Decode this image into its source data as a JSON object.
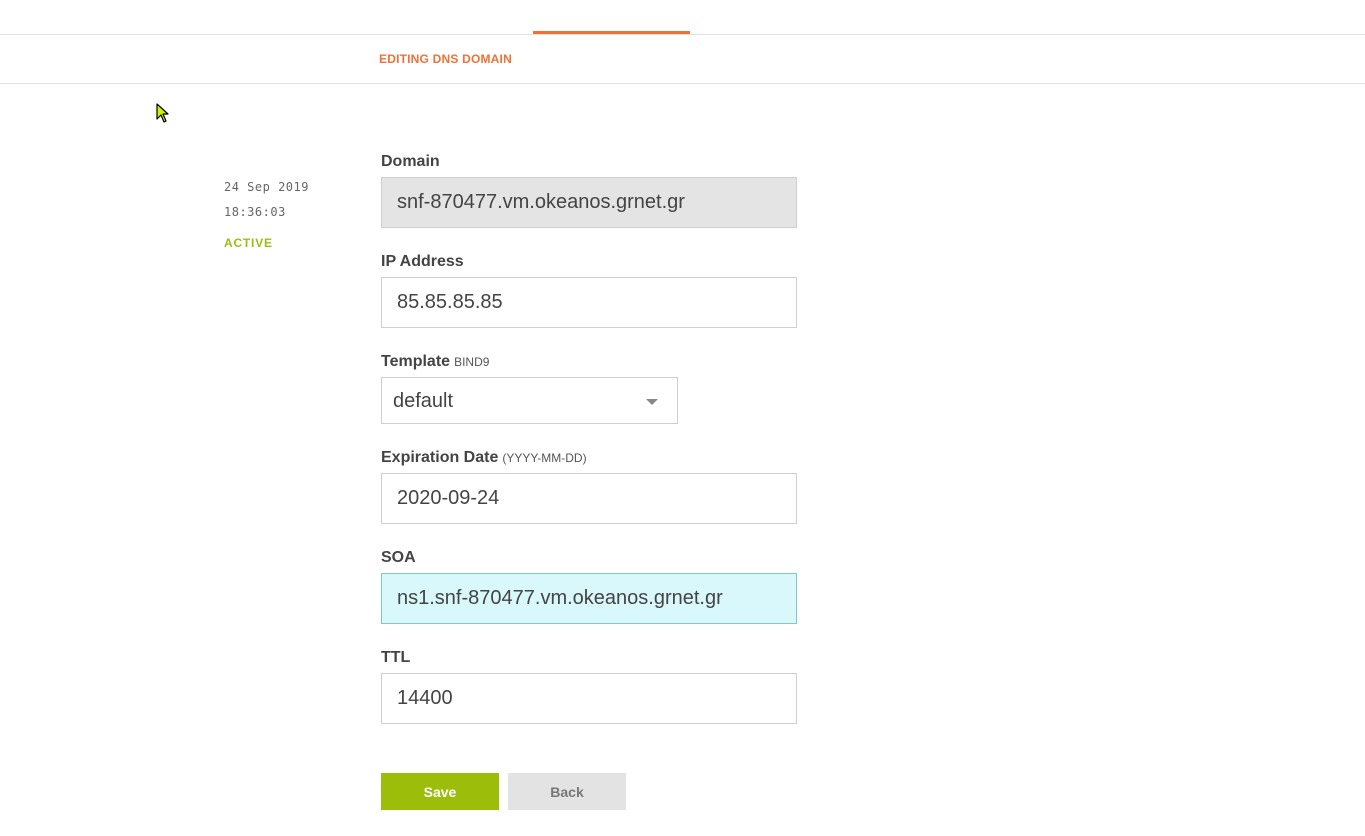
{
  "header": {
    "tab_title": "EDITING DNS DOMAIN"
  },
  "meta": {
    "date": "24 Sep 2019 18:36:03",
    "status": "ACTIVE"
  },
  "form": {
    "domain": {
      "label": "Domain",
      "value": "snf-870477.vm.okeanos.grnet.gr"
    },
    "ip_address": {
      "label": "IP Address",
      "value": "85.85.85.85"
    },
    "template": {
      "label": "Template",
      "hint": "BIND9",
      "selected": "default"
    },
    "expiration_date": {
      "label": "Expiration Date",
      "hint": "(YYYY-MM-DD)",
      "value": "2020-09-24"
    },
    "soa": {
      "label": "SOA",
      "value": "ns1.snf-870477.vm.okeanos.grnet.gr"
    },
    "ttl": {
      "label": "TTL",
      "value": "14400"
    }
  },
  "buttons": {
    "save": "Save",
    "back": "Back"
  },
  "colors": {
    "accent": "#f07137",
    "status_active": "#9cbd14",
    "save_button": "#9cbd0a",
    "focused_input": "#d8f8fc"
  },
  "icons": {
    "cursor": "mouse-pointer-icon",
    "select_caret": "caret-down-icon"
  }
}
